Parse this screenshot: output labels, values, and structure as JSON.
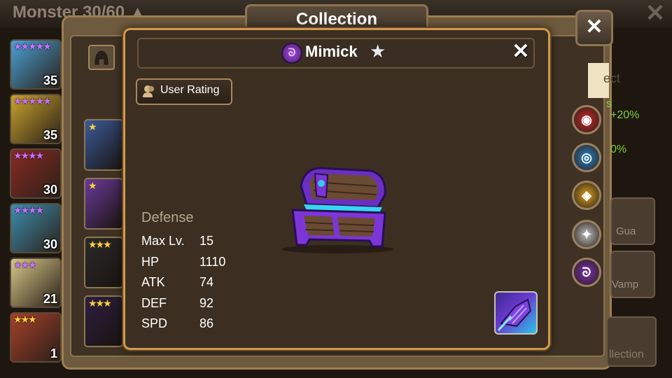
{
  "topbar": {
    "monster_count": "Monster 30/60 ▲",
    "close_glyph": "✕"
  },
  "collection": {
    "title": "Collection",
    "close_glyph": "✕",
    "select_text": "ect",
    "bonus_lines": [
      "s",
      "+20%",
      "0%"
    ],
    "element_filters": [
      {
        "name": "fire",
        "color": "#c8272a",
        "glyph": "◉"
      },
      {
        "name": "water",
        "color": "#2a82c8",
        "glyph": "◎"
      },
      {
        "name": "wind",
        "color": "#d6a020",
        "glyph": "◈"
      },
      {
        "name": "light",
        "color": "#bdbdbd",
        "glyph": "✦"
      },
      {
        "name": "dark",
        "color": "#7b2db0",
        "glyph": "ᘐ"
      }
    ],
    "guard_label": "Gua",
    "vamp_label": "Vamp",
    "collection_label": "llection"
  },
  "monster_list": [
    {
      "stars": "★★★★★",
      "level": "35",
      "star_color": "purple",
      "bg": "#4aa3d8"
    },
    {
      "stars": "★★★★★",
      "level": "35",
      "star_color": "purple",
      "bg": "#c9a52c"
    },
    {
      "stars": "★★★★",
      "level": "30",
      "star_color": "purple",
      "bg": "#8a2a24"
    },
    {
      "stars": "★★★★",
      "level": "30",
      "star_color": "purple",
      "bg": "#3c8fb0"
    },
    {
      "stars": "★★★",
      "level": "21",
      "star_color": "purple",
      "bg": "#d8c88a"
    },
    {
      "stars": "★★★",
      "level": "1",
      "star_color": "gold",
      "bg": "#a8402a"
    }
  ],
  "collection_cards": [
    {
      "stars": "★",
      "bg": "#3a5a9a"
    },
    {
      "stars": "★",
      "bg": "#6a3a9a"
    },
    {
      "stars": "★★★",
      "bg": "#2a2a2a"
    },
    {
      "stars": "★★★",
      "bg": "#2e1e40"
    }
  ],
  "modal": {
    "monster_name": "Mimick",
    "name_star": "★",
    "element_glyph": "ᘐ",
    "close_glyph": "✕",
    "user_rating_label": "User Rating",
    "monster_type": "Defense",
    "stats": [
      {
        "label": "Max Lv.",
        "value": "15"
      },
      {
        "label": "HP",
        "value": "1110"
      },
      {
        "label": "ATK",
        "value": "74"
      },
      {
        "label": "DEF",
        "value": "92"
      },
      {
        "label": "SPD",
        "value": "86"
      }
    ]
  }
}
